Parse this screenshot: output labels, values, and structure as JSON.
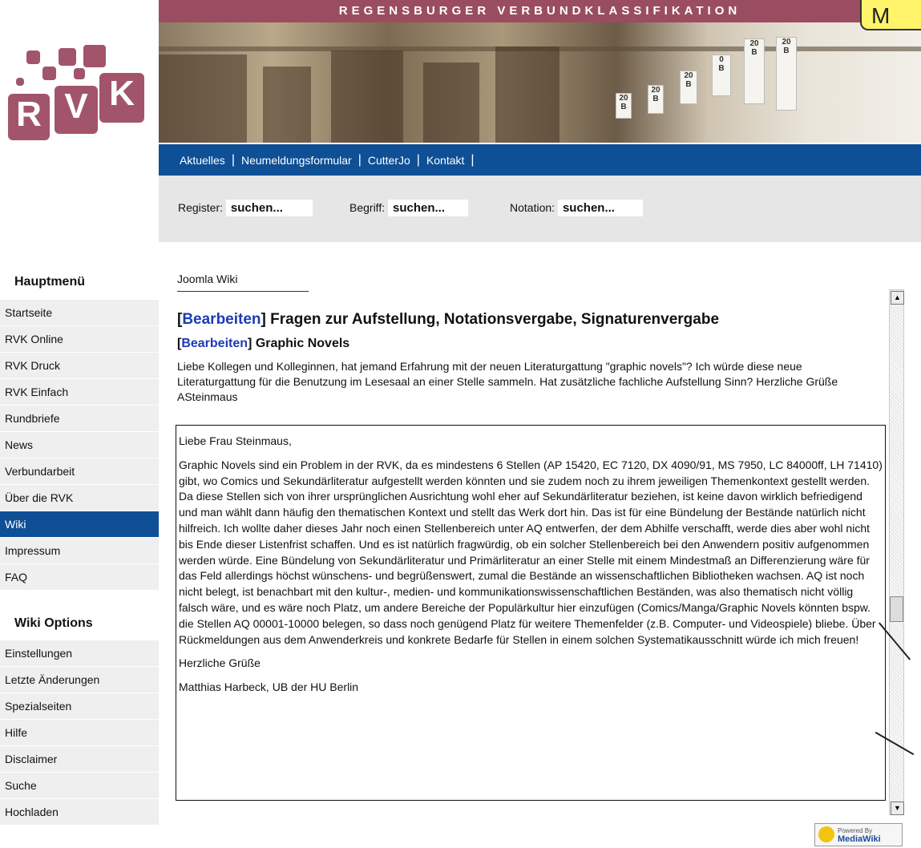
{
  "header": {
    "title": "REGENSBURGER VERBUNDKLASSIFIKATION",
    "badge": "M",
    "logo": {
      "letters": [
        "R",
        "V",
        "K"
      ],
      "color": "#a2556a"
    },
    "banner_labels": [
      "20",
      "B",
      "20",
      "B",
      "20",
      "B",
      "0",
      "B",
      "20",
      "B",
      "20",
      "B"
    ]
  },
  "nav": {
    "items": [
      "Aktuelles",
      "Neumeldungsformular",
      "CutterJo",
      "Kontakt"
    ],
    "color": "#0e4f96"
  },
  "search": {
    "register": {
      "label": "Register:",
      "value": "suchen..."
    },
    "begriff": {
      "label": "Begriff:",
      "value": "suchen..."
    },
    "notation": {
      "label": "Notation:",
      "value": "suchen..."
    }
  },
  "sidebar": {
    "main_heading": "Hauptmenü",
    "main_items": [
      "Startseite",
      "RVK Online",
      "RVK Druck",
      "RVK Einfach",
      "Rundbriefe",
      "News",
      "Verbundarbeit",
      "Über die RVK",
      "Wiki",
      "Impressum",
      "FAQ"
    ],
    "active_item": "Wiki",
    "wiki_heading": "Wiki Options",
    "wiki_items": [
      "Einstellungen",
      "Letzte Änderungen",
      "Spezialseiten",
      "Hilfe",
      "Disclaimer",
      "Suche",
      "Hochladen"
    ]
  },
  "content": {
    "breadcrumb": "Joomla Wiki",
    "edit_label": "Bearbeiten",
    "h1": "Fragen zur Aufstellung, Notationsvergabe, Signaturenvergabe",
    "h2": "Graphic Novels",
    "question": "Liebe Kollegen und Kolleginnen, hat jemand Erfahrung mit der neuen Literaturgattung \"graphic novels\"? Ich würde diese neue Literaturgattung für die Benutzung im Lesesaal an einer Stelle sammeln. Hat zusätzliche fachliche Aufstellung Sinn? Herzliche Grüße ASteinmaus",
    "reply": {
      "greeting": "Liebe Frau Steinmaus,",
      "body": "Graphic Novels sind ein Problem in der RVK, da es mindestens 6 Stellen (AP 15420, EC 7120, DX 4090/91, MS 7950, LC 84000ff, LH 71410) gibt, wo Comics und Sekundärliteratur aufgestellt werden könnten und sie zudem noch zu ihrem jeweiligen Themenkontext gestellt werden. Da diese Stellen sich von ihrer ursprünglichen Ausrichtung wohl eher auf Sekundärliteratur beziehen, ist keine davon wirklich befriedigend und man wählt dann häufig den thematischen Kontext und stellt das Werk dort hin. Das ist für eine Bündelung der Bestände natürlich nicht hilfreich. Ich wollte daher dieses Jahr noch einen Stellenbereich unter AQ entwerfen, der dem Abhilfe verschafft, werde dies aber wohl nicht bis Ende dieser Listenfrist schaffen. Und es ist natürlich fragwürdig, ob ein solcher Stellenbereich bei den Anwendern positiv aufgenommen werden würde. Eine Bündelung von Sekundärliteratur und Primärliteratur an einer Stelle mit einem Mindestmaß an Differenzierung wäre für das Feld allerdings höchst wünschens- und begrüßenswert, zumal die Bestände an wissenschaftlichen Bibliotheken wachsen. AQ ist noch nicht belegt, ist benachbart mit den kultur-, medien- und kommunikationswissenschaftlichen Beständen, was also thematisch nicht völlig falsch wäre, und es wäre noch Platz, um andere Bereiche der Populärkultur hier einzufügen (Comics/Manga/Graphic Novels könnten bspw. die Stellen AQ 00001-10000 belegen, so dass noch genügend Platz für weitere Themenfelder (z.B. Computer- und Videospiele) bliebe. Über Rückmeldungen aus dem Anwenderkreis und konkrete Bedarfe für Stellen in einem solchen Systematikausschnitt würde ich mich freuen!",
      "closing": "Herzliche Grüße",
      "signature": "Matthias Harbeck, UB der HU Berlin"
    }
  },
  "footer": {
    "powered_by": "Powered By",
    "mediawiki": "MediaWiki"
  }
}
